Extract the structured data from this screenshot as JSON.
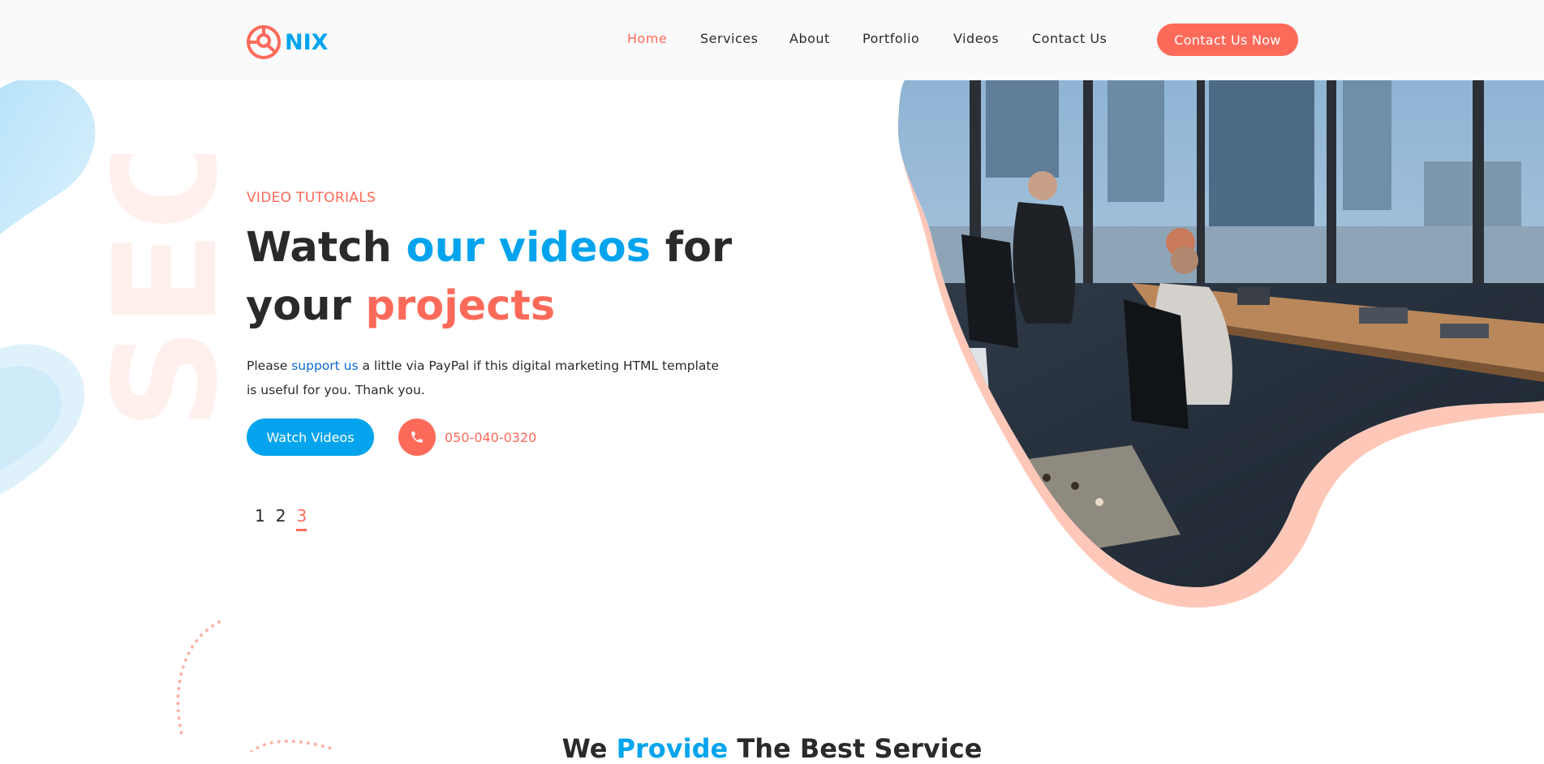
{
  "brand": {
    "name": "NIX"
  },
  "colors": {
    "accent_red": "#fe6a5a",
    "accent_blue": "#03a4ed",
    "text_dark": "#2a2a2a"
  },
  "nav": {
    "items": [
      {
        "label": "Home",
        "active": true
      },
      {
        "label": "Services",
        "active": false
      },
      {
        "label": "About",
        "active": false
      },
      {
        "label": "Portfolio",
        "active": false
      },
      {
        "label": "Videos",
        "active": false
      },
      {
        "label": "Contact Us",
        "active": false
      }
    ],
    "cta_label": "Contact Us Now"
  },
  "decor": {
    "watermark_text": "SEO"
  },
  "hero": {
    "tag": "VIDEO TUTORIALS",
    "title_part1": "Watch ",
    "title_highlight1": "our videos",
    "title_part2": " for your ",
    "title_highlight2": "projects",
    "desc_before": "Please ",
    "desc_link": "support us",
    "desc_after": " a little via PayPal if this digital marketing HTML template is useful for you. Thank you.",
    "button_label": "Watch Videos",
    "phone": "050-040-0320",
    "pages": [
      "1",
      "2",
      "3"
    ],
    "current_page": "3"
  },
  "section": {
    "title_part1": "We ",
    "title_highlight": "Provide",
    "title_part2": " The Best Service"
  }
}
